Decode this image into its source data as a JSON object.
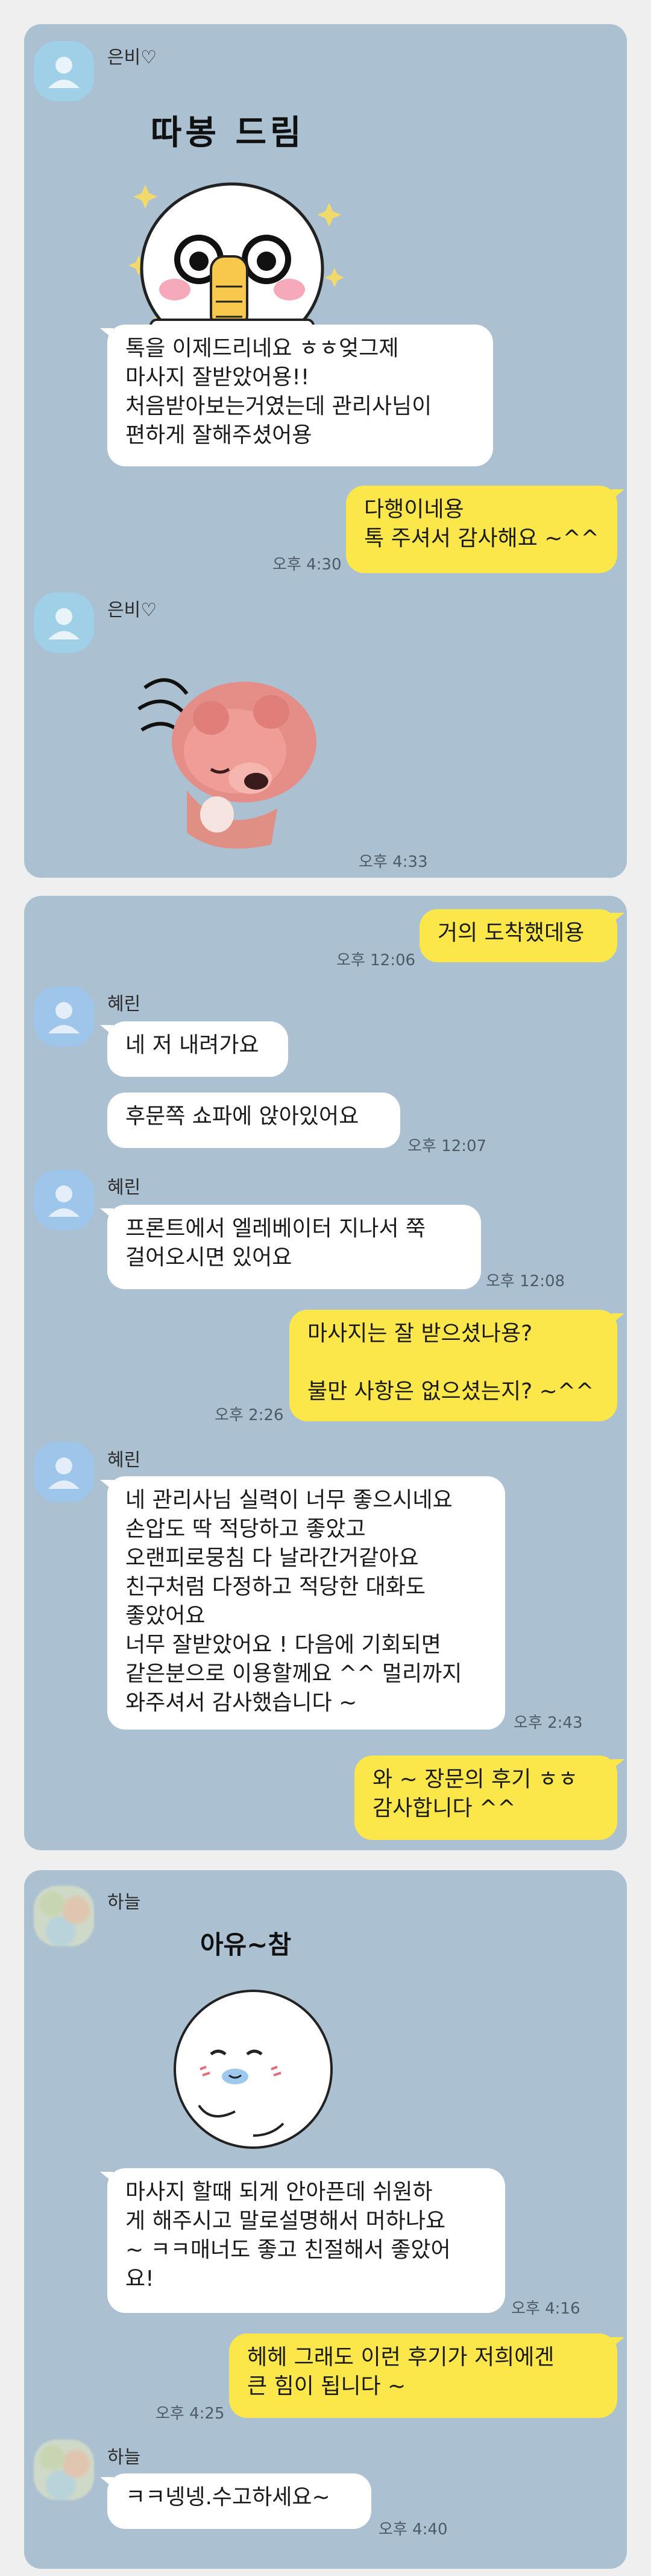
{
  "panel1": {
    "sender": "은비♡",
    "sticker1_caption": "따봉 드림",
    "msg1": "톡을 이제드리네요 ㅎㅎ엊그제\n마사지 잘받았어용!!\n처음받아보는거였는데 관리사님이\n편하게 잘해주셨어용",
    "reply1": "다행이네용\n톡 주셔서 감사해요 ~^^",
    "reply1_time": "오후 4:30",
    "sender2": "은비♡",
    "sticker2_time": "오후 4:33"
  },
  "panel2": {
    "out1": "거의 도착했데용",
    "out1_time": "오후 12:06",
    "sender": "혜린",
    "in1": "네 저 내려가요",
    "in2": "후문쪽 쇼파에 앉아있어요",
    "in2_time": "오후 12:07",
    "sender2": "혜린",
    "in3": "프론트에서 엘레베이터 지나서 쭉\n걸어오시면 있어요",
    "in3_time": "오후 12:08",
    "out2": "마사지는 잘 받으셨나용?\n\n불만 사항은 없으셨는지? ~^^",
    "out2_time": "오후 2:26",
    "sender3": "혜린",
    "in4": "네 관리사님 실력이 너무 좋으시네요\n손압도 딱 적당하고 좋았고\n오랜피로뭉침 다 날라간거같아요\n친구처럼 다정하고 적당한 대화도\n좋았어요\n너무 잘받았어요 ! 다음에 기회되면\n같은분으로 이용할께요 ^^ 멀리까지\n와주셔서 감사했습니다 ~",
    "in4_time": "오후 2:43",
    "out3": "와 ~ 장문의 후기 ㅎㅎ\n감사합니다 ^^"
  },
  "panel3": {
    "sender": "하늘",
    "sticker_caption": "아유~참",
    "in1": "마사지 할때 되게 안아픈데 쉬원하\n게 해주시고 말로설명해서 머하나요\n~ ㅋㅋ매너도 좋고 친절해서 좋았어\n요!",
    "in1_time": "오후 4:16",
    "out1": "헤헤 그래도 이런 후기가 저희에겐\n큰 힘이 됩니다 ~",
    "out1_time": "오후 4:25",
    "sender2": "하늘",
    "in2": "ㅋㅋ넹넹.수고하세요~",
    "in2_time": "오후 4:40"
  },
  "colors": {
    "chat_background": "#abc1d1",
    "outgoing_bubble": "#fbe74a",
    "incoming_bubble": "#ffffff"
  }
}
